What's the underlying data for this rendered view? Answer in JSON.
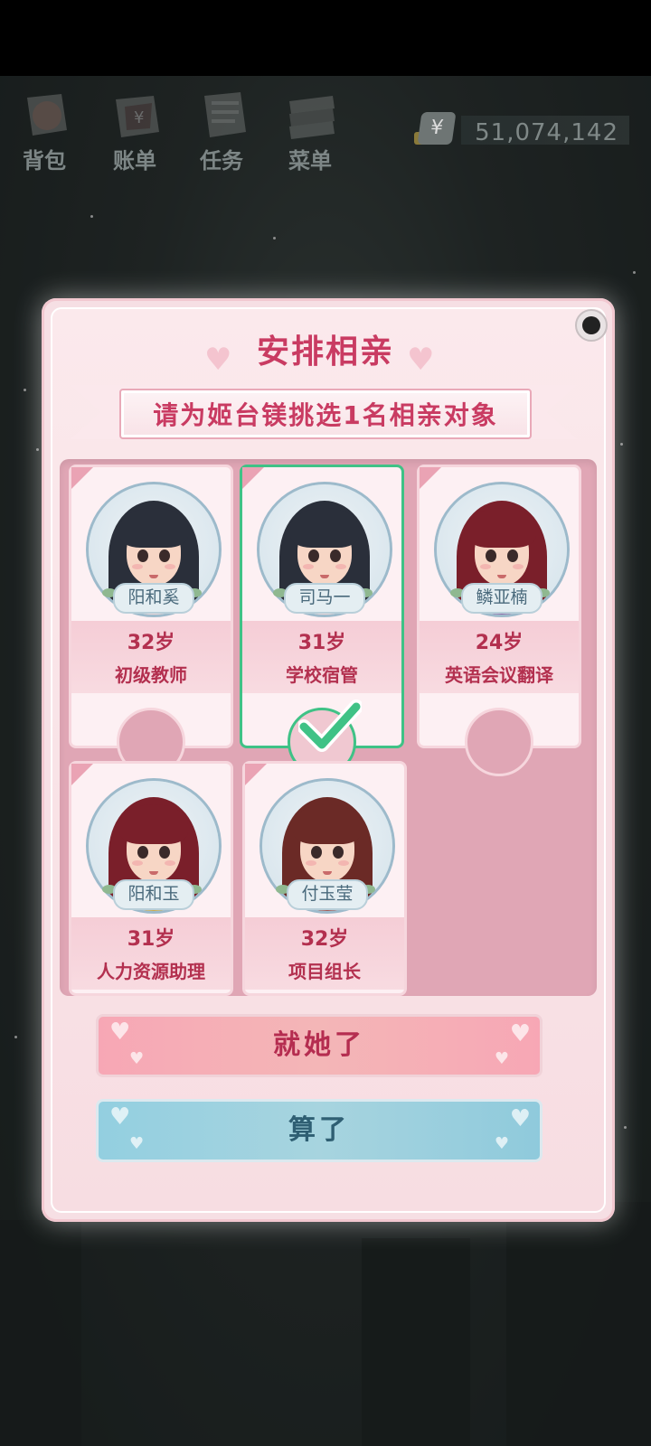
{
  "toolbar": {
    "items": [
      {
        "label": "背包",
        "icon": "backpack-icon"
      },
      {
        "label": "账单",
        "icon": "bill-icon"
      },
      {
        "label": "任务",
        "icon": "task-icon"
      },
      {
        "label": "菜单",
        "icon": "menu-icon"
      }
    ],
    "currency_symbol": "¥",
    "money": "51,074,142"
  },
  "dialog": {
    "title": "安排相亲",
    "subtitle": "请为姬台镁挑选1名相亲对象",
    "candidates": [
      {
        "name": "阳和奚",
        "age": "32岁",
        "job": "初级教师",
        "hair": "#2a2f3a",
        "shirt": "#f2d5d5",
        "selected": false
      },
      {
        "name": "司马一",
        "age": "31岁",
        "job": "学校宿管",
        "hair": "#2a2f3a",
        "shirt": "#f2d5d5",
        "selected": true
      },
      {
        "name": "鳞亚楠",
        "age": "24岁",
        "job": "英语会议翻译",
        "hair": "#7a1f2a",
        "shirt": "#8f6aa8",
        "selected": false
      },
      {
        "name": "阳和玉",
        "age": "31岁",
        "job": "人力资源助理",
        "hair": "#7a1f2a",
        "shirt": "#c9a94a",
        "selected": false
      },
      {
        "name": "付玉莹",
        "age": "32岁",
        "job": "项目组长",
        "hair": "#6b2a26",
        "shirt": "#a05a55",
        "selected": false
      }
    ],
    "confirm_label": "就她了",
    "cancel_label": "算了"
  },
  "colors": {
    "accent": "#c93b62",
    "selected_border": "#3fc286",
    "dialog_bg": "#f6dfe4"
  }
}
